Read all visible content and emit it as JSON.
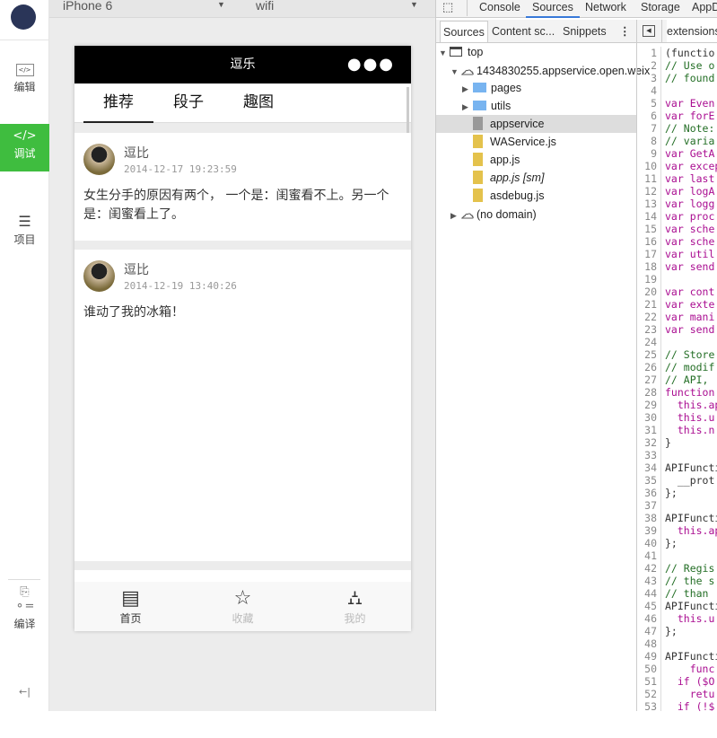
{
  "sidebar": {
    "items": [
      {
        "label": "编辑",
        "icon": "code-box-icon"
      },
      {
        "label": "调试",
        "icon": "code-icon",
        "active": true
      },
      {
        "label": "项目",
        "icon": "menu-icon"
      },
      {
        "label": "编译",
        "icon": "compile-icon"
      }
    ]
  },
  "simulator": {
    "device": "iPhone 6",
    "network": "wifi"
  },
  "app": {
    "title": "逗乐",
    "tabs": [
      "推荐",
      "段子",
      "趣图"
    ],
    "posts": [
      {
        "user": "逗比",
        "time": "2014-12-17 19:23:59",
        "content": "女生分手的原因有两个， 一个是：闺蜜看不上。另一个是：闺蜜看上了。"
      },
      {
        "user": "逗比",
        "time": "2014-12-19 13:40:26",
        "content": "谁动了我的冰箱！"
      }
    ],
    "tabbar": [
      {
        "label": "首页",
        "icon": "notepad-icon",
        "active": true
      },
      {
        "label": "收藏",
        "icon": "star-icon"
      },
      {
        "label": "我的",
        "icon": "user-icon"
      }
    ]
  },
  "devtools": {
    "tabs": [
      "Console",
      "Sources",
      "Network",
      "Storage",
      "AppD"
    ],
    "active_tab": "Sources",
    "subtabs": [
      "Sources",
      "Content sc...",
      "Snippets"
    ],
    "editor_tab": "extensions:",
    "tree": [
      {
        "label": "top",
        "type": "frame",
        "depth": 0
      },
      {
        "label": "1434830255.appservice.open.weix",
        "type": "cloud",
        "depth": 1
      },
      {
        "label": "pages",
        "type": "folder",
        "depth": 2
      },
      {
        "label": "utils",
        "type": "folder",
        "depth": 2
      },
      {
        "label": "appservice",
        "type": "file-gray",
        "depth": 2,
        "selected": true
      },
      {
        "label": "WAService.js",
        "type": "file",
        "depth": 2
      },
      {
        "label": "app.js",
        "type": "file",
        "depth": 2
      },
      {
        "label": "app.js [sm]",
        "type": "file",
        "depth": 2,
        "italic": true
      },
      {
        "label": "asdebug.js",
        "type": "file",
        "depth": 2
      },
      {
        "label": "(no domain)",
        "type": "cloud",
        "depth": 1
      }
    ],
    "code": [
      "(functio",
      "// Use o",
      "// found",
      "",
      "var Even",
      "var forE",
      "// Note:",
      "// varia",
      "var GetA",
      "var excep",
      "var last",
      "var logA",
      "var logg",
      "var proc",
      "var sche",
      "var sche",
      "var util",
      "var send",
      "",
      "var cont",
      "var exte",
      "var mani",
      "var send",
      "",
      "// Store",
      "// modif",
      "// API, ",
      "function",
      "  this.ap",
      "  this.u",
      "  this.n",
      "}",
      "",
      "APIFuncti",
      "  __prot",
      "};",
      "",
      "APIFuncti",
      "  this.ap",
      "};",
      "",
      "// Regis",
      "// the s",
      "// than ",
      "APIFuncti",
      "  this.u",
      "};",
      "",
      "APIFuncti",
      "    func",
      "  if ($O",
      "    retu",
      "  if (!$"
    ]
  }
}
